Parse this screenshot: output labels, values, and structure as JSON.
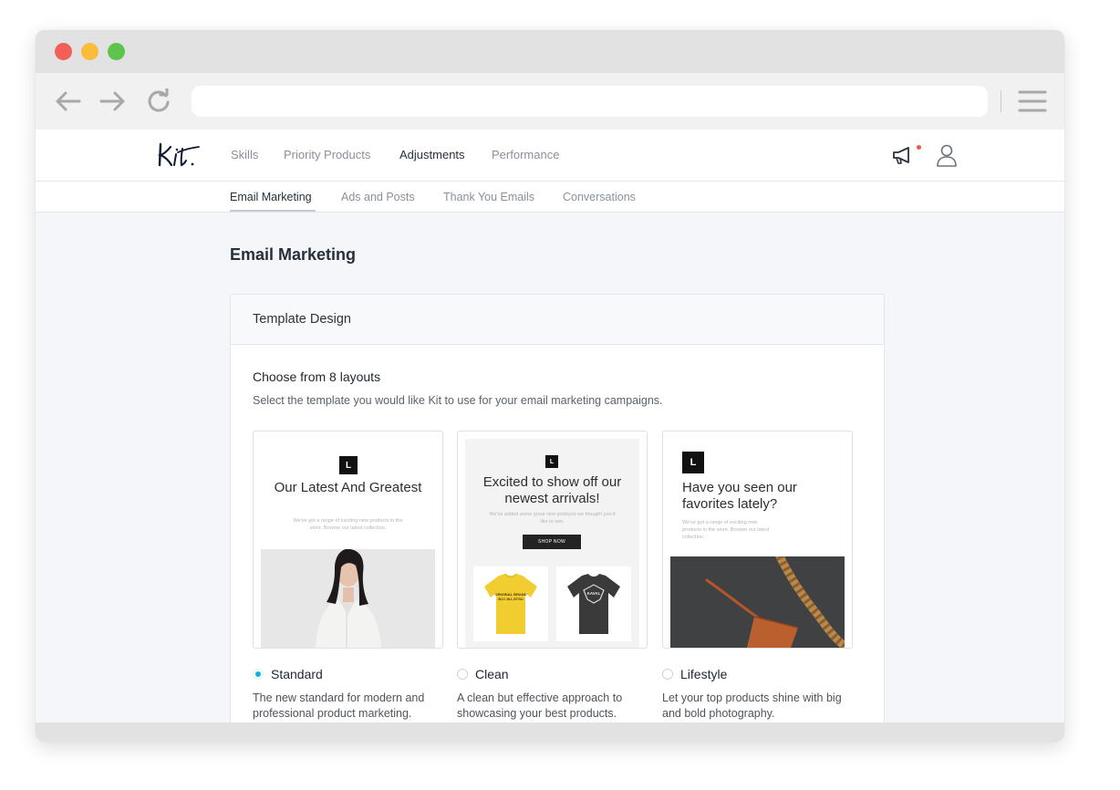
{
  "app": {
    "logo_text": "Kit."
  },
  "main_nav": {
    "items": [
      {
        "label": "Skills"
      },
      {
        "label": "Priority Products"
      },
      {
        "label": "Adjustments"
      },
      {
        "label": "Performance"
      }
    ],
    "active": "Adjustments"
  },
  "sub_nav": {
    "items": [
      {
        "label": "Email Marketing"
      },
      {
        "label": "Ads and Posts"
      },
      {
        "label": "Thank You Emails"
      },
      {
        "label": "Conversations"
      }
    ],
    "active": "Email Marketing"
  },
  "page": {
    "title": "Email Marketing"
  },
  "card": {
    "title": "Template Design",
    "heading": "Choose from 8 layouts",
    "description": "Select the template you would like Kit to use for your email marketing campaigns."
  },
  "templates": [
    {
      "name": "Standard",
      "selected": true,
      "description": "The new standard for modern and professional product marketing.",
      "preview": {
        "logo_letter": "L",
        "headline": "Our Latest And Greatest",
        "body": "We've got a range of exciting new products in the store. Browse our latest collection."
      }
    },
    {
      "name": "Clean",
      "selected": false,
      "description": "A clean but effective approach to showcasing your best products.",
      "preview": {
        "logo_letter": "L",
        "headline": "Excited to show off our newest arrivals!",
        "body": "We've added some great new products we thought you'd like to see.",
        "button": "SHOP NOW",
        "product1_text": "ORIGINAL BRAND BJJ JIU-JITSU",
        "product2_text": "KAVAL"
      }
    },
    {
      "name": "Lifestyle",
      "selected": false,
      "description": "Let your top products shine with big and bold photography.",
      "preview": {
        "logo_letter": "L",
        "headline": "Have you seen our favorites lately?",
        "body": "We've got a range of exciting new products in the store. Browse our latest collection."
      }
    }
  ],
  "colors": {
    "accent": "#11b2d6",
    "notification": "#f1574c",
    "text_primary": "#27303a",
    "text_muted": "#8a9099"
  },
  "icons": {
    "back": "arrow-left-icon",
    "forward": "arrow-right-icon",
    "reload": "reload-icon",
    "menu": "hamburger-menu-icon",
    "announcements": "megaphone-icon",
    "account": "user-icon"
  }
}
